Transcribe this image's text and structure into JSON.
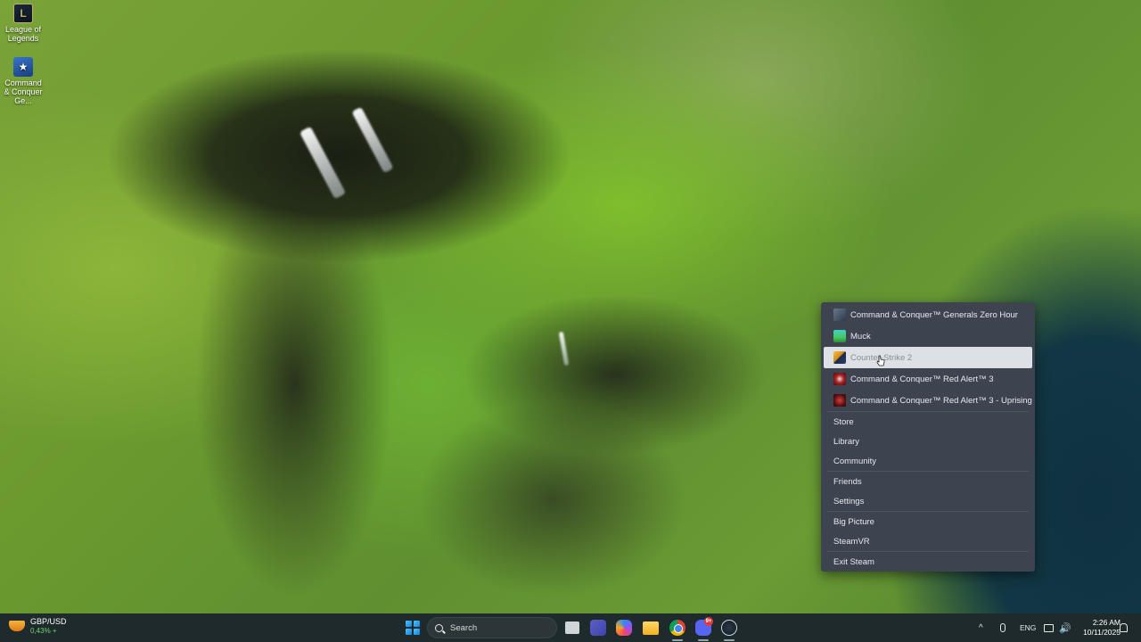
{
  "desktop": {
    "icons": [
      {
        "label": "League of Legends",
        "icon": "league-of-legends-icon",
        "glyph": "L"
      },
      {
        "label": "Command & Conquer Ge...",
        "icon": "command-and-conquer-icon",
        "glyph": "★"
      }
    ]
  },
  "context_menu": {
    "recent_games": [
      {
        "label": "Command & Conquer™ Generals Zero Hour",
        "icon": "cnc-zero-hour-icon"
      },
      {
        "label": "Muck",
        "icon": "muck-icon"
      },
      {
        "label": "Counter-Strike 2",
        "icon": "counter-strike-2-icon",
        "hovered": true
      },
      {
        "label": "Command & Conquer™ Red Alert™ 3",
        "icon": "red-alert-3-icon"
      },
      {
        "label": "Command & Conquer™ Red Alert™ 3 - Uprising",
        "icon": "red-alert-3-uprising-icon"
      }
    ],
    "nav_items": [
      "Store",
      "Library",
      "Community"
    ],
    "account_items": [
      "Friends",
      "Settings"
    ],
    "mode_items": [
      "Big Picture",
      "SteamVR"
    ],
    "exit_item": "Exit Steam"
  },
  "taskbar": {
    "widget": {
      "title": "GBP/USD",
      "value": "0,43% +",
      "icon": "stocks-icon"
    },
    "search_placeholder": "Search",
    "apps": [
      "task-view-icon",
      "teams-chat-icon",
      "copilot-icon",
      "file-explorer-icon",
      "chrome-icon",
      "discord-icon",
      "steam-icon"
    ],
    "discord_badge": "9+",
    "tray": {
      "chevron": "^",
      "language": "ENG",
      "volume_glyph": "🔊",
      "time": "2:26 AM",
      "date": "10/11/2025"
    }
  }
}
